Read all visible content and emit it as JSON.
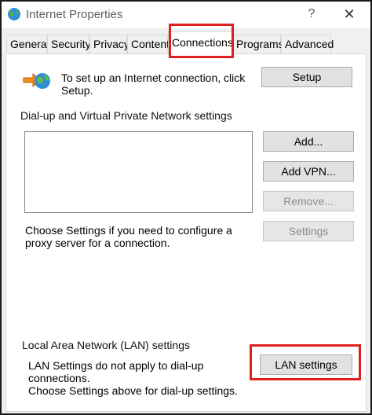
{
  "window": {
    "title": "Internet Properties",
    "help_glyph": "?",
    "close_glyph": "✕"
  },
  "tabs": [
    {
      "label": "General"
    },
    {
      "label": "Security"
    },
    {
      "label": "Privacy"
    },
    {
      "label": "Content"
    },
    {
      "label": "Connections",
      "active": true
    },
    {
      "label": "Programs"
    },
    {
      "label": "Advanced"
    }
  ],
  "setup": {
    "text": "To set up an Internet connection, click Setup.",
    "button": "Setup"
  },
  "dialup": {
    "heading": "Dial-up and Virtual Private Network settings",
    "add_button": "Add...",
    "add_vpn_button": "Add VPN...",
    "remove_button": "Remove...",
    "proxy_text": "Choose Settings if you need to configure a proxy server for a connection.",
    "settings_button": "Settings"
  },
  "lan": {
    "heading": "Local Area Network (LAN) settings",
    "text_line1": "LAN Settings do not apply to dial-up connections.",
    "text_line2": "Choose Settings above for dial-up settings.",
    "button": "LAN settings"
  },
  "colors": {
    "highlight": "#e02020",
    "panel": "#ffffff",
    "chrome": "#f0f0f0"
  },
  "icons": {
    "app": "internet-options-globe-icon",
    "setup": "network-globe-arrow-icon"
  }
}
